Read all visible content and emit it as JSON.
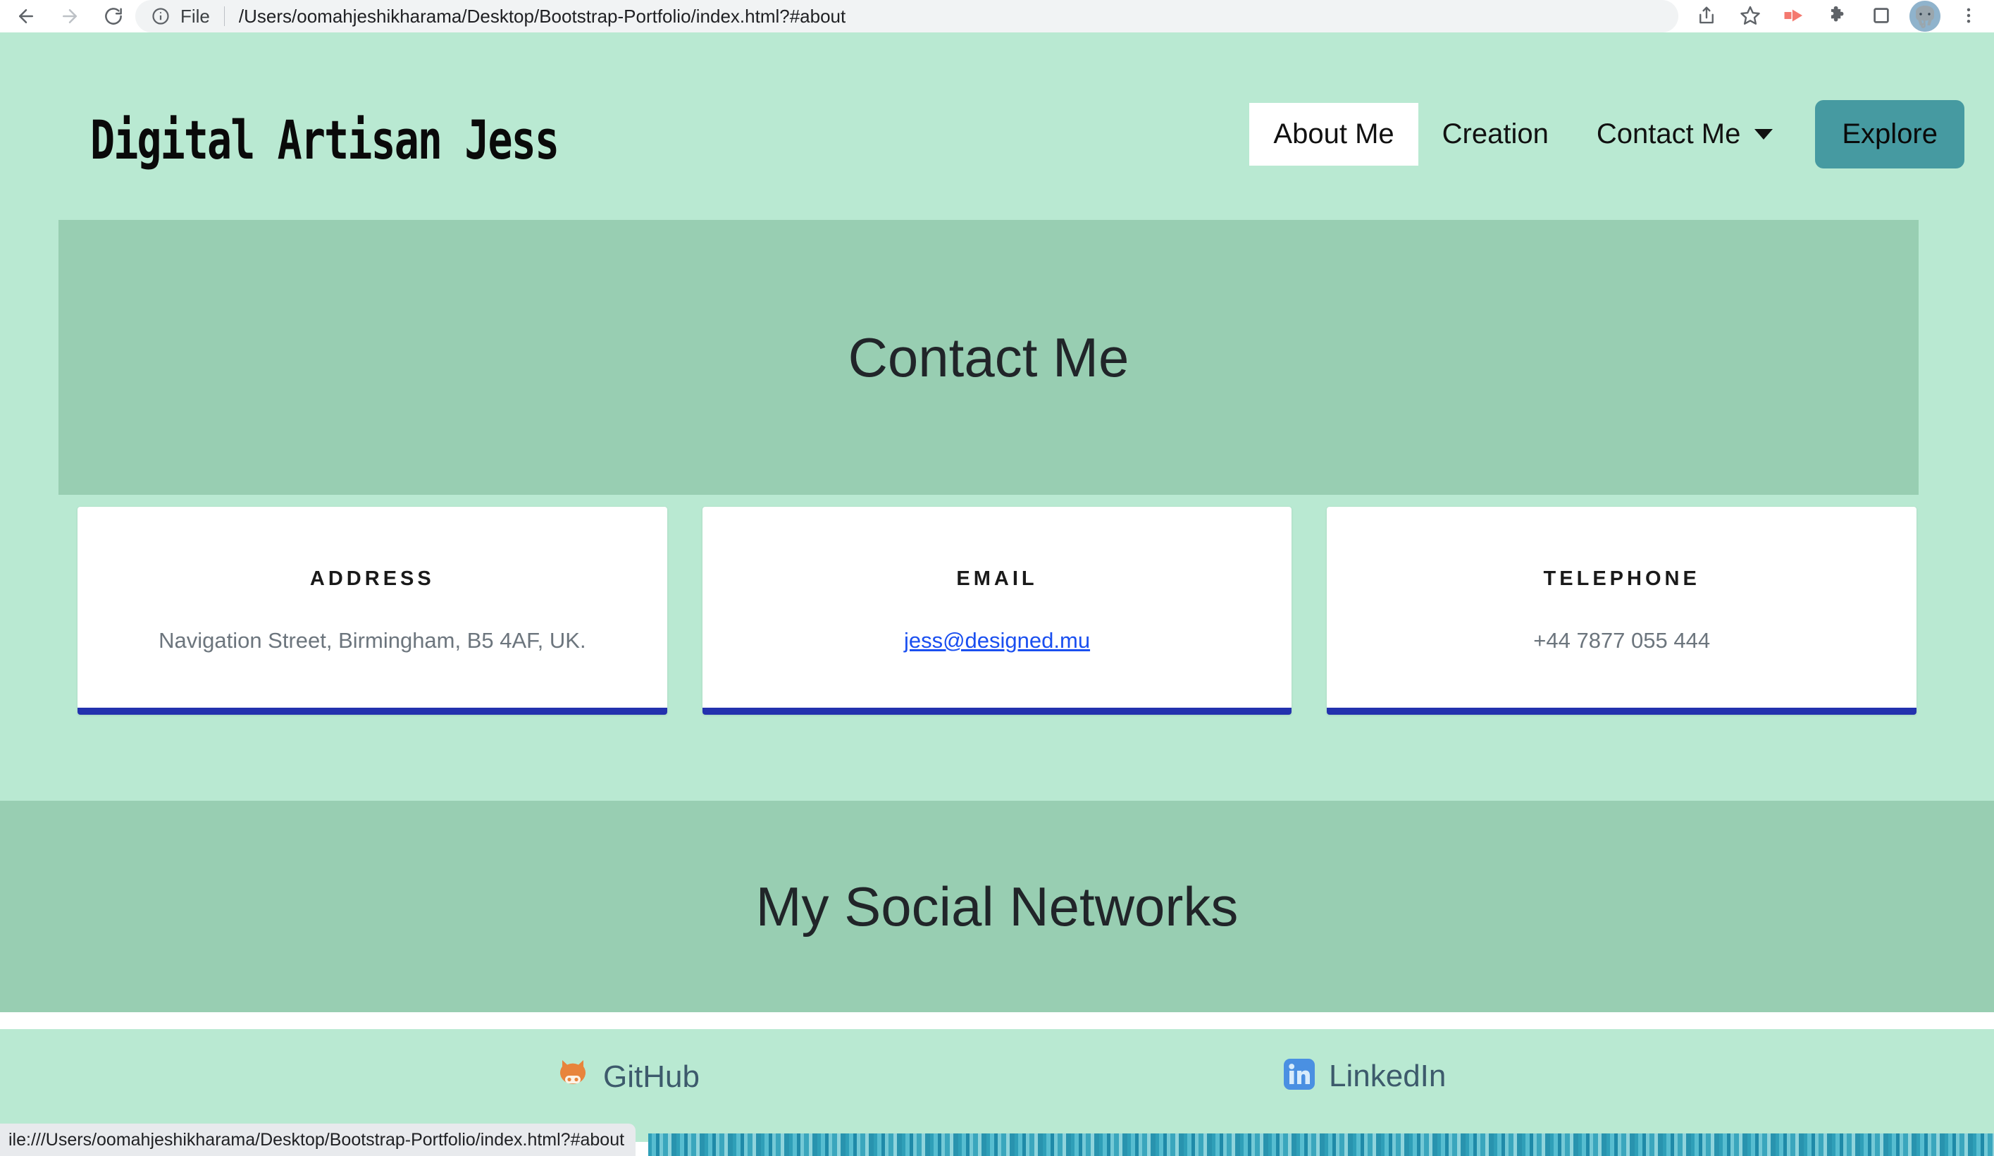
{
  "browser": {
    "back_label": "Back",
    "forward_label": "Forward",
    "reload_label": "Reload",
    "scheme_label": "File",
    "url": "/Users/oomahjeshikharama/Desktop/Bootstrap-Portfolio/index.html?#about",
    "icons": {
      "back": "back-arrow-icon",
      "forward": "forward-arrow-icon",
      "reload": "reload-icon",
      "info": "info-circle-icon",
      "share": "share-icon",
      "bookmark": "star-bookmark-icon",
      "extension_red": "red-play-extension-icon",
      "extensions": "puzzle-piece-icon",
      "side_panel": "side-panel-icon",
      "profile": "elephant-avatar-icon",
      "menu": "three-dot-menu-icon"
    },
    "status_bar_text": "ile:///Users/oomahjeshikharama/Desktop/Bootstrap-Portfolio/index.html?#about"
  },
  "site": {
    "brand": "Digital Artisan Jess",
    "nav": [
      {
        "label": "About Me",
        "active": true,
        "has_caret": false
      },
      {
        "label": "Creation",
        "active": false,
        "has_caret": false
      },
      {
        "label": "Contact Me",
        "active": false,
        "has_caret": true
      }
    ],
    "cta_label": "Explore"
  },
  "hero": {
    "title": "Contact Me"
  },
  "contact_cards": [
    {
      "title": "ADDRESS",
      "value": "Navigation Street, Birmingham, B5 4AF, UK.",
      "is_link": false
    },
    {
      "title": "EMAIL",
      "value": "jess@designed.mu",
      "is_link": true
    },
    {
      "title": "TELEPHONE",
      "value": "+44 7877 055 444",
      "is_link": false
    }
  ],
  "social": {
    "heading": "My Social Networks",
    "links": [
      {
        "label": "GitHub",
        "icon": "github-octocat-icon"
      },
      {
        "label": "LinkedIn",
        "icon": "linkedin-icon"
      }
    ]
  },
  "colors": {
    "page_background": "#b9e9d2",
    "banner_background": "#98ceb2",
    "cta_teal": "#469aa1",
    "card_border_blue": "#2332ae",
    "link_blue": "#1a4ff0",
    "muted_text": "#6c757d",
    "github_orange": "#e8843c",
    "linkedin_blue": "#4a90e2",
    "social_label": "#3d5a6c"
  }
}
